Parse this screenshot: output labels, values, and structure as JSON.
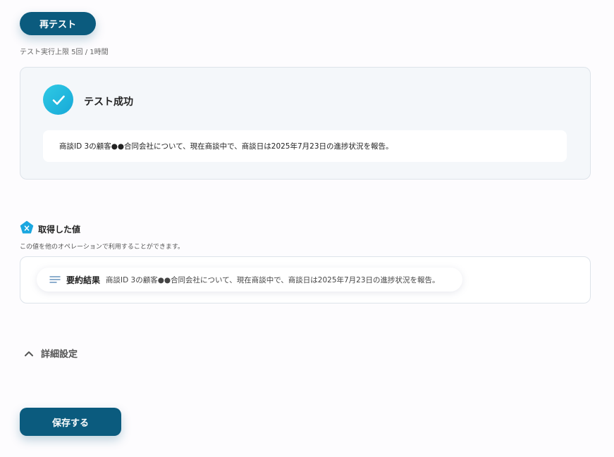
{
  "retest": {
    "label": "再テスト"
  },
  "limit_text": "テスト実行上限 5回 / 1時間",
  "result": {
    "title": "テスト成功",
    "message": "商談ID 3の顧客●●合同会社について、現在商談中で、商談日は2025年7月23日の進捗状況を報告。"
  },
  "values_section": {
    "title": "取得した値",
    "subtitle": "この値を他のオペレーションで利用することができます。",
    "items": [
      {
        "label": "要約結果",
        "value": "商談ID 3の顧客●●合同会社について、現在商談中で、商談日は2025年7月23日の進捗状況を報告。"
      }
    ]
  },
  "details": {
    "label": "詳細設定"
  },
  "save": {
    "label": "保存する"
  },
  "colors": {
    "primary": "#0b5b7e",
    "success_gradient_start": "#2fc9e4",
    "success_gradient_end": "#17a9d8",
    "card_bg": "#f4f7fa",
    "badge_blue": "#1aa7e0"
  },
  "icons": {
    "success": "check-circle-icon",
    "values": "variable-pentagon-icon",
    "item": "text-lines-icon",
    "toggle": "chevron-up-icon"
  }
}
